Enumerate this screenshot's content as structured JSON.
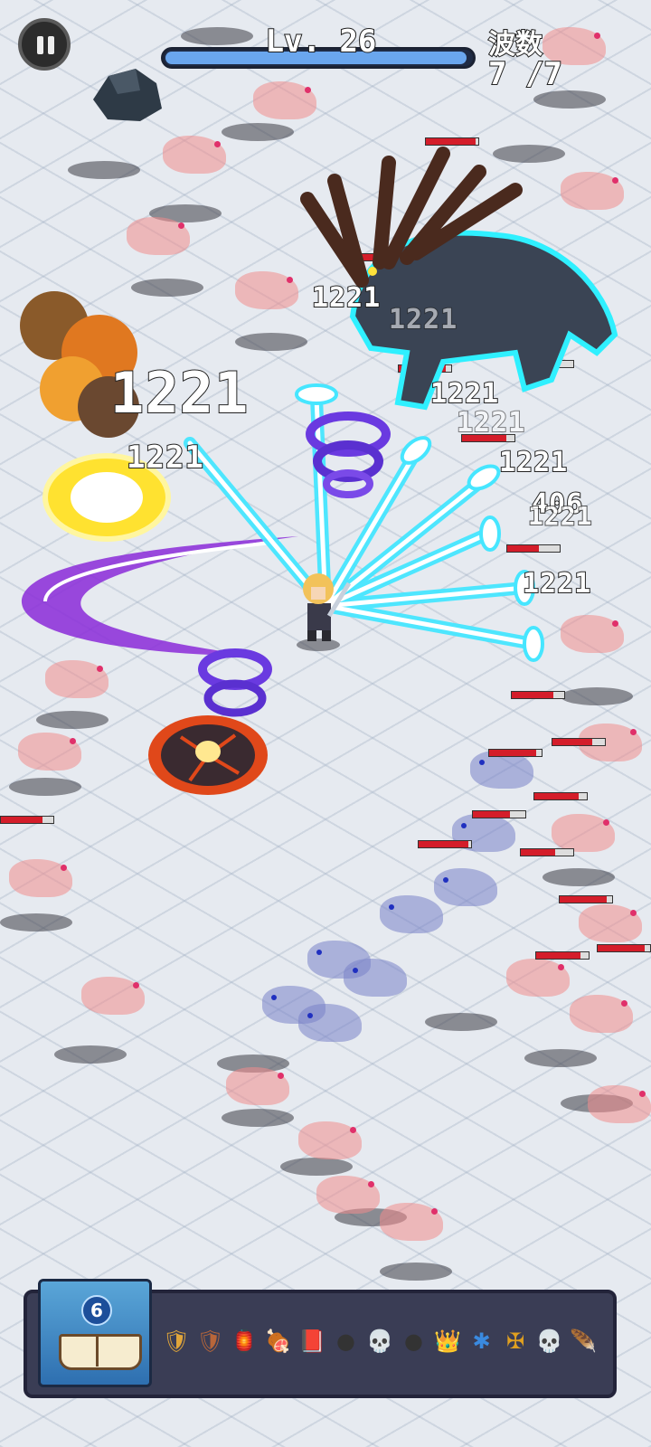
{
  "hud": {
    "level_text": "Lv. 26",
    "xp_progress": 0.98,
    "wave_label": "波数",
    "wave_value": "7 /7"
  },
  "damage_numbers": [
    "1221",
    "1221",
    "1221",
    "1221",
    "1221",
    "1221",
    "406",
    "1221",
    "1221",
    "1221"
  ],
  "skillbar": {
    "book_count": "6",
    "items": [
      {
        "icon": "armor-icon",
        "glyph": "🛡",
        "color": "#e0a53a"
      },
      {
        "icon": "shield-icon",
        "glyph": "🛡",
        "color": "#b8663a"
      },
      {
        "icon": "lantern-icon",
        "glyph": "🏮",
        "color": "#4aa0e0"
      },
      {
        "icon": "meat-icon",
        "glyph": "🍖",
        "color": "#d0483a"
      },
      {
        "icon": "red-book-icon",
        "glyph": "📕",
        "color": "#c81e2e"
      },
      {
        "icon": "cannon-icon",
        "glyph": "●",
        "color": "#333"
      },
      {
        "icon": "skull-icon",
        "glyph": "💀",
        "color": "#eee"
      },
      {
        "icon": "cannon-icon",
        "glyph": "●",
        "color": "#333"
      },
      {
        "icon": "crown-icon",
        "glyph": "👑",
        "color": "#f0b020"
      },
      {
        "icon": "blue-shield-icon",
        "glyph": "✱",
        "color": "#3a8ae0"
      },
      {
        "icon": "winged-helmet-icon",
        "glyph": "✠",
        "color": "#e0a020"
      },
      {
        "icon": "skull-icon",
        "glyph": "💀",
        "color": "#eee"
      },
      {
        "icon": "feather-icon",
        "glyph": "🪶",
        "color": "#5aaae8"
      }
    ]
  }
}
